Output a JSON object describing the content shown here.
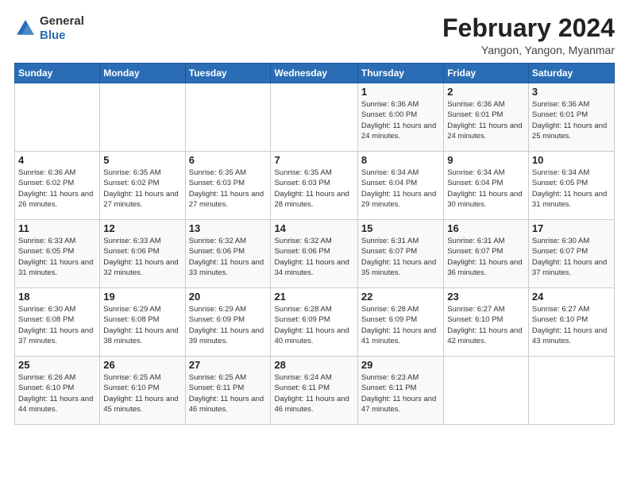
{
  "header": {
    "logo_line1": "General",
    "logo_line2": "Blue",
    "month": "February 2024",
    "location": "Yangon, Yangon, Myanmar"
  },
  "weekdays": [
    "Sunday",
    "Monday",
    "Tuesday",
    "Wednesday",
    "Thursday",
    "Friday",
    "Saturday"
  ],
  "weeks": [
    [
      {
        "day": "",
        "info": ""
      },
      {
        "day": "",
        "info": ""
      },
      {
        "day": "",
        "info": ""
      },
      {
        "day": "",
        "info": ""
      },
      {
        "day": "1",
        "info": "Sunrise: 6:36 AM\nSunset: 6:00 PM\nDaylight: 11 hours and 24 minutes."
      },
      {
        "day": "2",
        "info": "Sunrise: 6:36 AM\nSunset: 6:01 PM\nDaylight: 11 hours and 24 minutes."
      },
      {
        "day": "3",
        "info": "Sunrise: 6:36 AM\nSunset: 6:01 PM\nDaylight: 11 hours and 25 minutes."
      }
    ],
    [
      {
        "day": "4",
        "info": "Sunrise: 6:36 AM\nSunset: 6:02 PM\nDaylight: 11 hours and 26 minutes."
      },
      {
        "day": "5",
        "info": "Sunrise: 6:35 AM\nSunset: 6:02 PM\nDaylight: 11 hours and 27 minutes."
      },
      {
        "day": "6",
        "info": "Sunrise: 6:35 AM\nSunset: 6:03 PM\nDaylight: 11 hours and 27 minutes."
      },
      {
        "day": "7",
        "info": "Sunrise: 6:35 AM\nSunset: 6:03 PM\nDaylight: 11 hours and 28 minutes."
      },
      {
        "day": "8",
        "info": "Sunrise: 6:34 AM\nSunset: 6:04 PM\nDaylight: 11 hours and 29 minutes."
      },
      {
        "day": "9",
        "info": "Sunrise: 6:34 AM\nSunset: 6:04 PM\nDaylight: 11 hours and 30 minutes."
      },
      {
        "day": "10",
        "info": "Sunrise: 6:34 AM\nSunset: 6:05 PM\nDaylight: 11 hours and 31 minutes."
      }
    ],
    [
      {
        "day": "11",
        "info": "Sunrise: 6:33 AM\nSunset: 6:05 PM\nDaylight: 11 hours and 31 minutes."
      },
      {
        "day": "12",
        "info": "Sunrise: 6:33 AM\nSunset: 6:06 PM\nDaylight: 11 hours and 32 minutes."
      },
      {
        "day": "13",
        "info": "Sunrise: 6:32 AM\nSunset: 6:06 PM\nDaylight: 11 hours and 33 minutes."
      },
      {
        "day": "14",
        "info": "Sunrise: 6:32 AM\nSunset: 6:06 PM\nDaylight: 11 hours and 34 minutes."
      },
      {
        "day": "15",
        "info": "Sunrise: 6:31 AM\nSunset: 6:07 PM\nDaylight: 11 hours and 35 minutes."
      },
      {
        "day": "16",
        "info": "Sunrise: 6:31 AM\nSunset: 6:07 PM\nDaylight: 11 hours and 36 minutes."
      },
      {
        "day": "17",
        "info": "Sunrise: 6:30 AM\nSunset: 6:07 PM\nDaylight: 11 hours and 37 minutes."
      }
    ],
    [
      {
        "day": "18",
        "info": "Sunrise: 6:30 AM\nSunset: 6:08 PM\nDaylight: 11 hours and 37 minutes."
      },
      {
        "day": "19",
        "info": "Sunrise: 6:29 AM\nSunset: 6:08 PM\nDaylight: 11 hours and 38 minutes."
      },
      {
        "day": "20",
        "info": "Sunrise: 6:29 AM\nSunset: 6:09 PM\nDaylight: 11 hours and 39 minutes."
      },
      {
        "day": "21",
        "info": "Sunrise: 6:28 AM\nSunset: 6:09 PM\nDaylight: 11 hours and 40 minutes."
      },
      {
        "day": "22",
        "info": "Sunrise: 6:28 AM\nSunset: 6:09 PM\nDaylight: 11 hours and 41 minutes."
      },
      {
        "day": "23",
        "info": "Sunrise: 6:27 AM\nSunset: 6:10 PM\nDaylight: 11 hours and 42 minutes."
      },
      {
        "day": "24",
        "info": "Sunrise: 6:27 AM\nSunset: 6:10 PM\nDaylight: 11 hours and 43 minutes."
      }
    ],
    [
      {
        "day": "25",
        "info": "Sunrise: 6:26 AM\nSunset: 6:10 PM\nDaylight: 11 hours and 44 minutes."
      },
      {
        "day": "26",
        "info": "Sunrise: 6:25 AM\nSunset: 6:10 PM\nDaylight: 11 hours and 45 minutes."
      },
      {
        "day": "27",
        "info": "Sunrise: 6:25 AM\nSunset: 6:11 PM\nDaylight: 11 hours and 46 minutes."
      },
      {
        "day": "28",
        "info": "Sunrise: 6:24 AM\nSunset: 6:11 PM\nDaylight: 11 hours and 46 minutes."
      },
      {
        "day": "29",
        "info": "Sunrise: 6:23 AM\nSunset: 6:11 PM\nDaylight: 11 hours and 47 minutes."
      },
      {
        "day": "",
        "info": ""
      },
      {
        "day": "",
        "info": ""
      }
    ]
  ]
}
